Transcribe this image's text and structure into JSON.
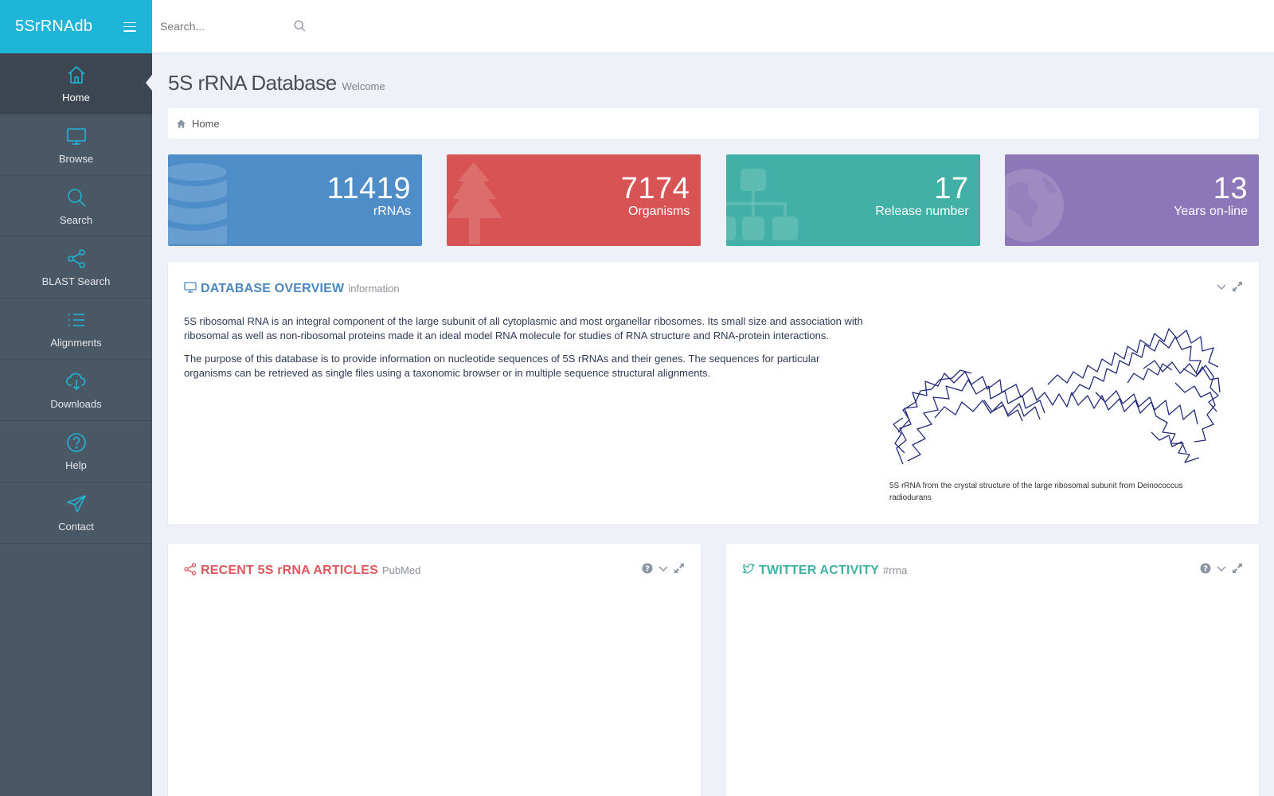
{
  "brand": {
    "name": "5SrRNAdb"
  },
  "search": {
    "placeholder": "Search..."
  },
  "sidebar": {
    "items": [
      {
        "label": "Home",
        "icon": "home-icon",
        "active": true
      },
      {
        "label": "Browse",
        "icon": "monitor-icon"
      },
      {
        "label": "Search",
        "icon": "search-icon"
      },
      {
        "label": "BLAST Search",
        "icon": "share-icon"
      },
      {
        "label": "Alignments",
        "icon": "list-icon"
      },
      {
        "label": "Downloads",
        "icon": "cloud-download-icon"
      },
      {
        "label": "Help",
        "icon": "help-circle-icon"
      },
      {
        "label": "Contact",
        "icon": "send-icon"
      }
    ]
  },
  "page": {
    "title": "5S rRNA Database",
    "subtitle": "Welcome"
  },
  "breadcrumb": {
    "home": "Home"
  },
  "stats": [
    {
      "value": "11419",
      "label": "rRNAs",
      "color": "#4f8dc9",
      "icon": "database-icon"
    },
    {
      "value": "7174",
      "label": "Organisms",
      "color": "#d85454",
      "icon": "tree-icon"
    },
    {
      "value": "17",
      "label": "Release number",
      "color": "#42b0a7",
      "icon": "sitemap-icon"
    },
    {
      "value": "13",
      "label": "Years on-line",
      "color": "#8c77b8",
      "icon": "globe-icon"
    }
  ],
  "overview": {
    "title": "DATABASE OVERVIEW",
    "subtitle": "information",
    "color": "#4a87c0",
    "paragraph1": "5S ribosomal RNA is an integral component of the large subunit of all cytoplasmic and most organellar ribosomes. Its small size and association with ribosomal as well as non-ribosomal proteins made it an ideal model RNA molecule for studies of RNA structure and RNA-protein interactions.",
    "paragraph2": "The purpose of this database is to provide information on nucleotide sequences of 5S rRNAs and their genes. The sequences for particular organisms can be retrieved as single files using a taxonomic browser or in multiple sequence structural alignments.",
    "caption": "5S rRNA from the crystal structure of the large ribosomal subunit from Deinococcus radiodurans"
  },
  "articles": {
    "title": "RECENT 5S rRNA ARTICLES",
    "subtitle": "PubMed",
    "color": "#e0585c"
  },
  "twitter": {
    "title": "TWITTER ACTIVITY",
    "subtitle": "#rrna",
    "color": "#3fb1a5"
  }
}
